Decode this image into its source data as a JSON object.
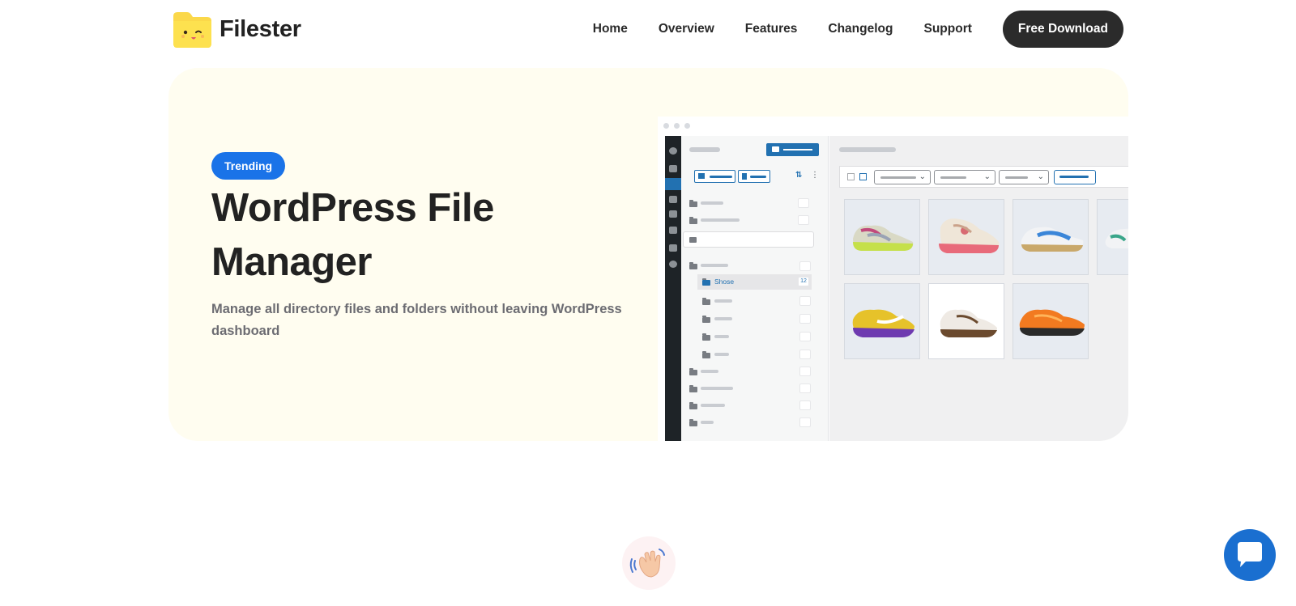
{
  "brand": {
    "name": "Filester"
  },
  "nav": {
    "items": [
      "Home",
      "Overview",
      "Features",
      "Changelog",
      "Support"
    ],
    "cta": "Free Download"
  },
  "hero": {
    "badge": "Trending",
    "title": "WordPress File Manager",
    "description": "Manage all directory files and folders without leaving WordPress dashboard"
  },
  "mockup": {
    "selected_folder": "Shose",
    "selected_count": "12"
  },
  "colors": {
    "accent": "#1a73e8",
    "cta_bg": "#2b2b2b",
    "hero_bg": "#fffdf0",
    "wp_blue": "#2271b1"
  }
}
